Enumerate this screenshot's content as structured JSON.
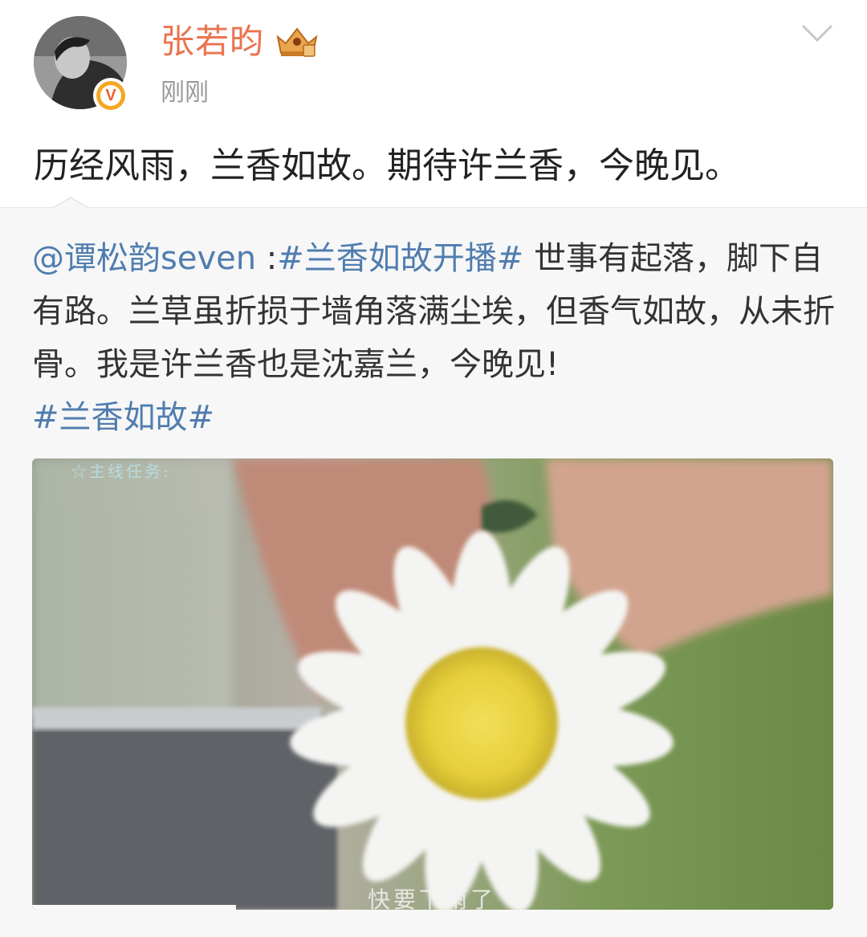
{
  "post": {
    "username": "张若昀",
    "time": "刚刚",
    "text": "历经风雨，兰香如故。期待许兰香，今晚见。",
    "verified_badge": "V"
  },
  "repost": {
    "mention": "@谭松韵seven",
    "separator": " :",
    "hashtag1": "#兰香如故开播#",
    "body": " 世事有起落，脚下自有路。兰草虽折损于墙角落满尘埃，但香气如故，从未折骨。我是许兰香也是沈嘉兰，今晚见!",
    "hashtag2": "#兰香如故#"
  },
  "media": {
    "overlay_top": "☆主线任务:",
    "subtitle": "快要下雨了",
    "progress": 0.255
  },
  "icons": {
    "crown": "crown-member-icon",
    "chevron": "chevron-down-icon",
    "verified": "verified-v-icon"
  },
  "colors": {
    "username": "#eb7350",
    "link": "#507daf",
    "time": "#999999"
  }
}
